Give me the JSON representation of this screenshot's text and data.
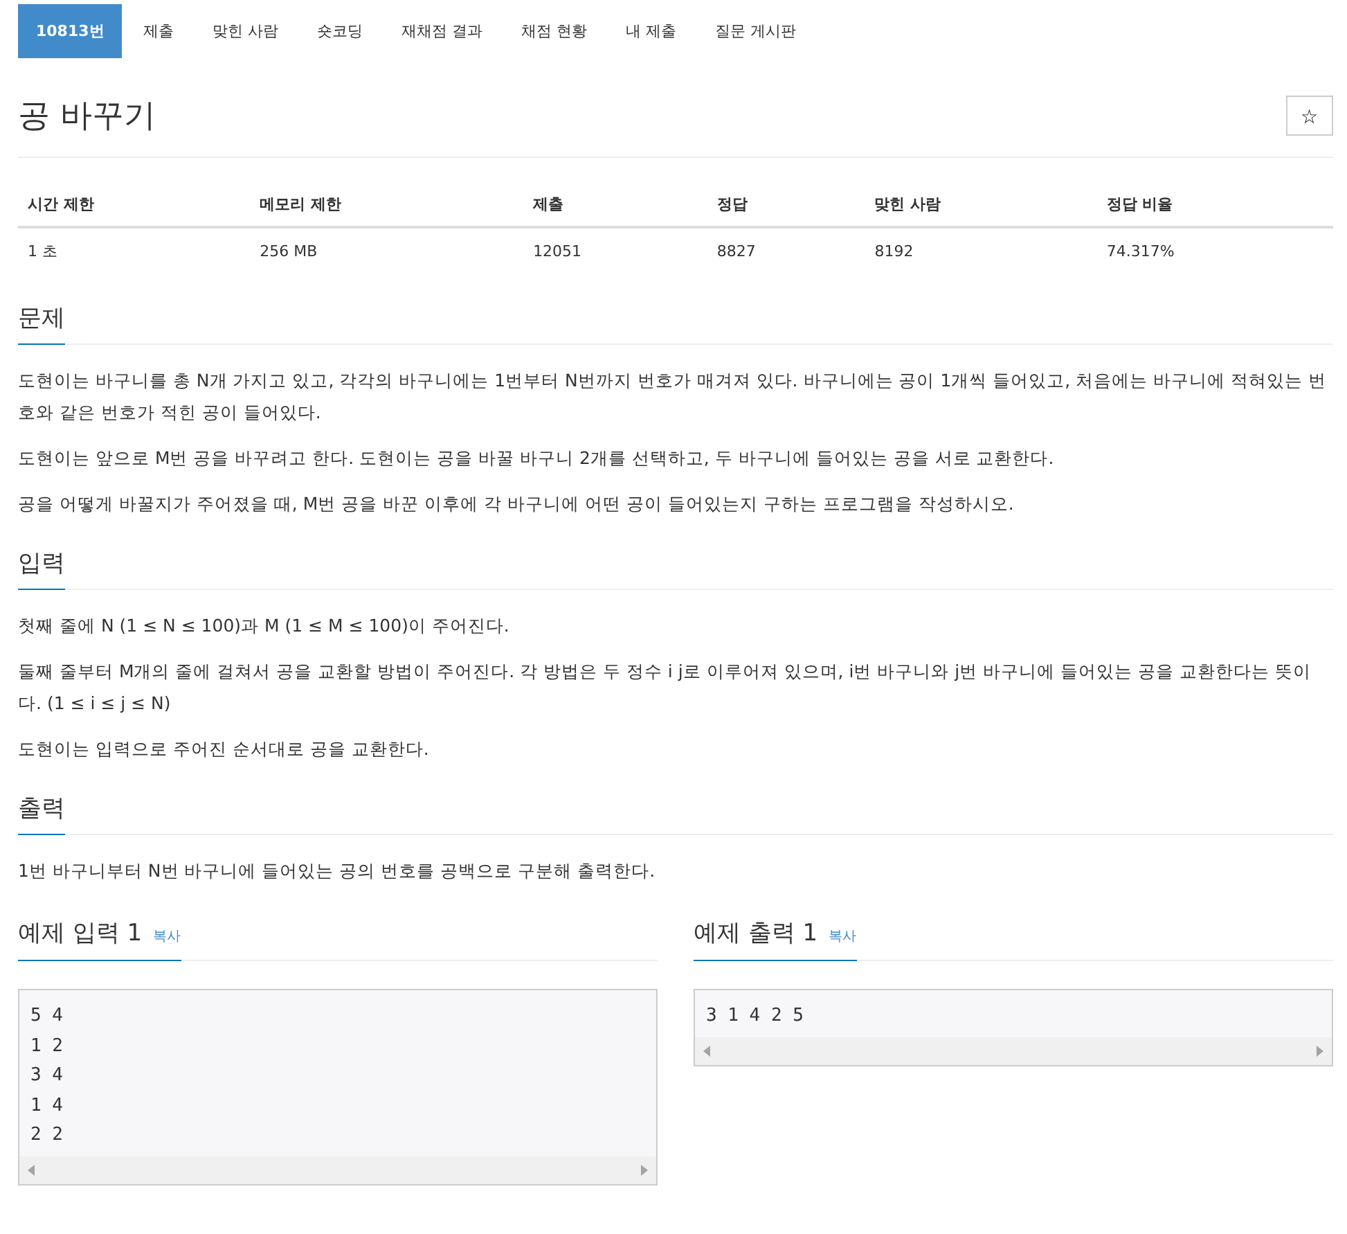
{
  "tabs": [
    {
      "label": "10813번",
      "selected": true
    },
    {
      "label": "제출",
      "selected": false
    },
    {
      "label": "맞힌 사람",
      "selected": false
    },
    {
      "label": "숏코딩",
      "selected": false
    },
    {
      "label": "재채점 결과",
      "selected": false
    },
    {
      "label": "채점 현황",
      "selected": false
    },
    {
      "label": "내 제출",
      "selected": false
    },
    {
      "label": "질문 게시판",
      "selected": false
    }
  ],
  "title": "공 바꾸기",
  "star_button": "☆",
  "info_table": {
    "columns": [
      "시간 제한",
      "메모리 제한",
      "제출",
      "정답",
      "맞힌 사람",
      "정답 비율"
    ],
    "row": [
      "1 초",
      "256 MB",
      "12051",
      "8827",
      "8192",
      "74.317%"
    ]
  },
  "sections": [
    {
      "heading": "문제",
      "paragraphs": [
        "도현이는 바구니를 총 N개 가지고 있고, 각각의 바구니에는 1번부터 N번까지 번호가 매겨져 있다. 바구니에는 공이 1개씩 들어있고, 처음에는 바구니에 적혀있는 번호와 같은 번호가 적힌 공이 들어있다.",
        "도현이는 앞으로 M번 공을 바꾸려고 한다. 도현이는 공을 바꿀 바구니 2개를 선택하고, 두 바구니에 들어있는 공을 서로 교환한다.",
        "공을 어떻게 바꿀지가 주어졌을 때, M번 공을 바꾼 이후에 각 바구니에 어떤 공이 들어있는지 구하는 프로그램을 작성하시오."
      ]
    },
    {
      "heading": "입력",
      "paragraphs": [
        "첫째 줄에 N (1 ≤ N ≤ 100)과 M (1 ≤ M ≤ 100)이 주어진다.",
        "둘째 줄부터 M개의 줄에 걸쳐서 공을 교환할 방법이 주어진다. 각 방법은 두 정수 i j로 이루어져 있으며, i번 바구니와 j번 바구니에 들어있는 공을 교환한다는 뜻이다. (1 ≤ i ≤ j ≤ N)",
        "도현이는 입력으로 주어진 순서대로 공을 교환한다."
      ]
    },
    {
      "heading": "출력",
      "paragraphs": [
        "1번 바구니부터 N번 바구니에 들어있는 공의 번호를 공백으로 구분해 출력한다."
      ]
    }
  ],
  "samples": [
    {
      "title": "예제 입력 1",
      "copy": "복사",
      "lines": [
        "5 4",
        "1 2",
        "3 4",
        "1 4",
        "2 2"
      ]
    },
    {
      "title": "예제 출력 1",
      "copy": "복사",
      "lines": [
        "3 1 4 2 5"
      ]
    }
  ]
}
